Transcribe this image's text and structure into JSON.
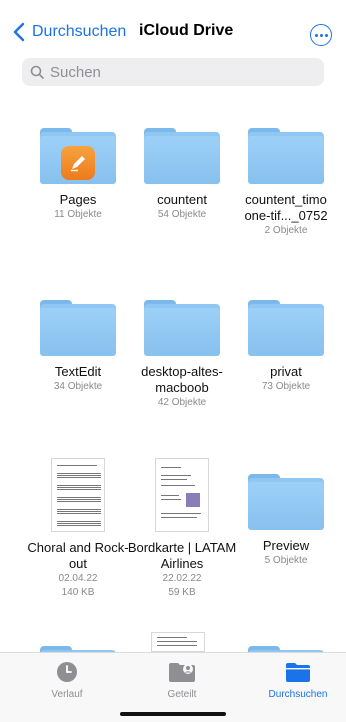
{
  "nav": {
    "back_label": "Durchsuchen",
    "title": "iCloud Drive",
    "more_icon": "ellipsis-circle-icon",
    "accent": "#1a73e8"
  },
  "search": {
    "placeholder": "Suchen"
  },
  "items": [
    {
      "name": "Pages",
      "meta": [
        "11 Objekte"
      ],
      "kind": "folder-app"
    },
    {
      "name": "countent",
      "meta": [
        "54 Objekte"
      ],
      "kind": "folder"
    },
    {
      "name": "countent_timo one-tif..._0752",
      "meta": [
        "2 Objekte"
      ],
      "kind": "folder"
    },
    {
      "name": "TextEdit",
      "meta": [
        "34 Objekte"
      ],
      "kind": "folder"
    },
    {
      "name": "desktop-altes-macboob",
      "meta": [
        "42 Objekte"
      ],
      "kind": "folder"
    },
    {
      "name": "privat",
      "meta": [
        "73 Objekte"
      ],
      "kind": "folder"
    },
    {
      "name": "Choral and Rock-out",
      "meta": [
        "02.04.22",
        "140 KB"
      ],
      "kind": "document"
    },
    {
      "name": "Bordkarte | LATAM Airlines",
      "meta": [
        "22.02.22",
        "59 KB"
      ],
      "kind": "document"
    },
    {
      "name": "Preview",
      "meta": [
        "5 Objekte"
      ],
      "kind": "folder"
    }
  ],
  "tabs": [
    {
      "label": "Verlauf",
      "icon": "clock-icon",
      "active": false
    },
    {
      "label": "Geteilt",
      "icon": "shared-folder-icon",
      "active": false
    },
    {
      "label": "Durchsuchen",
      "icon": "folder-icon",
      "active": true
    }
  ]
}
